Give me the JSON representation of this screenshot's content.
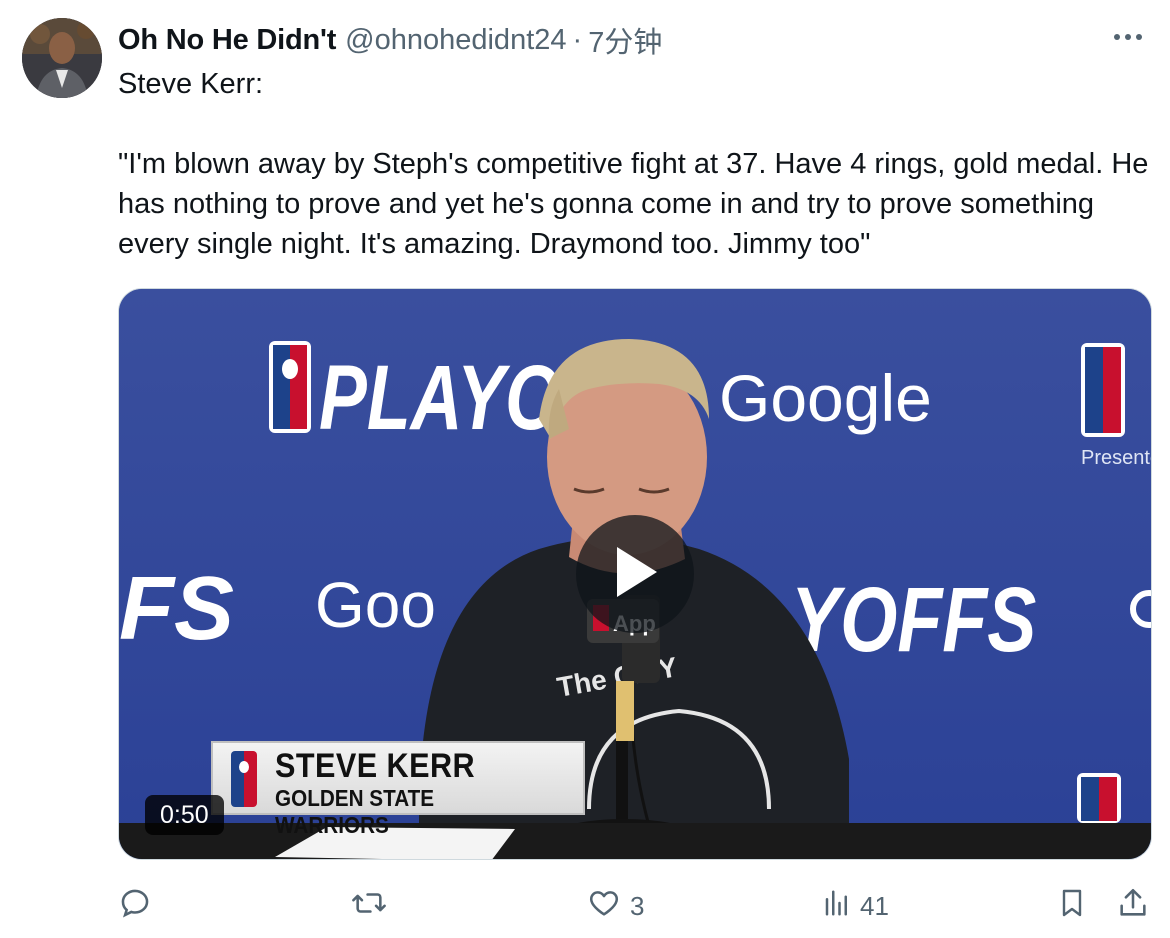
{
  "tweet": {
    "display_name": "Oh No He Didn't",
    "handle": "@ohnohedidnt24",
    "separator": "·",
    "time": "7分钟",
    "text": "Steve Kerr:\n\n\"I'm blown away by Steph's competitive fight at 37. Have 4 rings, gold medal. He has nothing to prove and yet he's gonna come in and try to prove something every single night. It's amazing. Draymond too. Jimmy too\""
  },
  "video": {
    "duration": "0:50",
    "lower_third_name": "STEVE KERR",
    "lower_third_team": "GOLDEN STATE WARRIORS",
    "backdrop_text_playoffs": "PLAYOFFS",
    "backdrop_text_google": "Google",
    "backdrop_text_goog": "Goo",
    "backdrop_text_yoffs": "YOFFS",
    "backdrop_text_fs": "FS",
    "backdrop_text_presented": "Presented by",
    "backdrop_text_nba": "NBA",
    "mic_flag_text": "App",
    "shirt_text": "The CITY"
  },
  "actions": {
    "reply_count": "",
    "retweet_count": "",
    "like_count": "3",
    "views_count": "41"
  },
  "colors": {
    "backdrop_blue": "#2f479b",
    "text_primary": "#0f1419",
    "text_secondary": "#536471"
  }
}
